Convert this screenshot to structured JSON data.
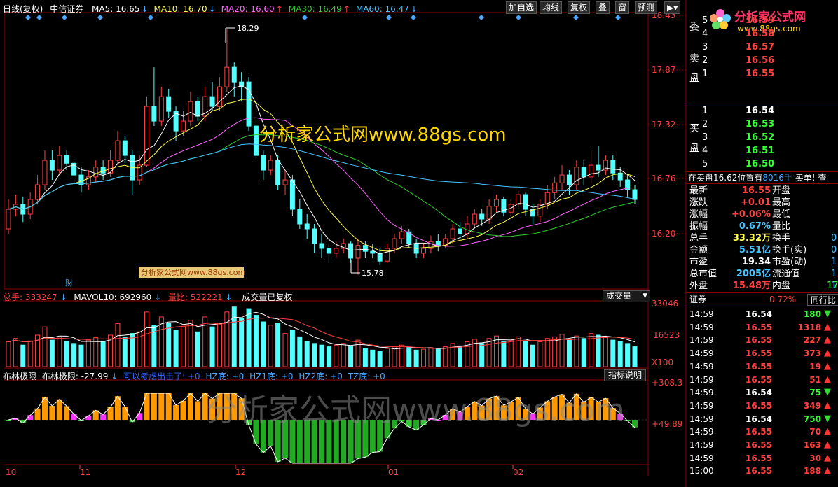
{
  "header": {
    "period": "日线(复权)",
    "stock": "中信证券",
    "ma": [
      {
        "label": "MA5: 16.65",
        "arrow": "↓",
        "arrowColor": "#49a7ff",
        "color": "#ffffff"
      },
      {
        "label": "MA10: 16.70",
        "arrow": "↓",
        "arrowColor": "#49a7ff",
        "color": "#ffff4d"
      },
      {
        "label": "MA20: 16.60",
        "arrow": "↑",
        "arrowColor": "#ff4040",
        "color": "#ff66ff"
      },
      {
        "label": "MA30: 16.49",
        "arrow": "↑",
        "arrowColor": "#ff4040",
        "color": "#33cc33"
      },
      {
        "label": "MA60: 16.47",
        "arrow": "↓",
        "arrowColor": "#49a7ff",
        "color": "#49c3ff"
      }
    ],
    "buttons": [
      "加自选",
      "均线",
      "复权",
      "叠",
      "窗",
      "预测"
    ]
  },
  "price_axis": [
    "18.43",
    "17.87",
    "17.32",
    "16.76",
    "16.20"
  ],
  "annotations": {
    "high": "18.29",
    "low": "15.78",
    "cai": "财"
  },
  "watermark_main": "分析家公式网www.88gs.com",
  "watermark_small": "分析家公式网www.88gs.com",
  "watermark_big": "分析家公式网www.88gs.com",
  "logo": {
    "title": "分析家公式网",
    "url": "www.88gs.com"
  },
  "volume_header": {
    "total_label": "总手: ",
    "total": "333247",
    "total_arrow": "↓",
    "mavol": "MAVOL10: 692960",
    "mavol_arrow": "↓",
    "liangbi_label": "量比: ",
    "liangbi": "522221",
    "liangbi_arrow": "↓",
    "note": "成交量已复权",
    "selector": "成交量"
  },
  "volume_axis": [
    "33046",
    "16523",
    "X100"
  ],
  "indicator_header": {
    "name": "布林极限",
    "value": "布林极限: -27.99",
    "arrow": "↓",
    "extra": "可以考虑出击了: +0",
    "hz": "HZ底: +0",
    "hz1": "HZ1底: +0",
    "hz2": "HZ2底: +0",
    "tz": "TZ底: +0",
    "help": "指标说明"
  },
  "indicator_axis": [
    "+308.3",
    "+49.89"
  ],
  "date_axis": [
    "10",
    "11",
    "12",
    "01",
    "02"
  ],
  "orderbook": {
    "sell_label": [
      "卖",
      "盘"
    ],
    "buy_label": [
      "买",
      "盘"
    ],
    "top_label": "委",
    "sells": [
      {
        "level": "5",
        "price": "16.59"
      },
      {
        "level": "4",
        "price": "16.58"
      },
      {
        "level": "3",
        "price": "16.57"
      },
      {
        "level": "2",
        "price": "16.56"
      },
      {
        "level": "1",
        "price": "16.55"
      }
    ],
    "buys": [
      {
        "level": "1",
        "price": "16.54"
      },
      {
        "level": "2",
        "price": "16.53"
      },
      {
        "level": "3",
        "price": "16.52"
      },
      {
        "level": "4",
        "price": "16.51"
      },
      {
        "level": "5",
        "price": "16.50"
      }
    ],
    "status": "在卖盘16.62位置有",
    "status_qty": "8016手",
    "status_action": "卖单! 查"
  },
  "stats": [
    {
      "l": "最新",
      "v": "16.55",
      "vc": "#ff4040",
      "r": "开盘"
    },
    {
      "l": "涨跌",
      "v": "+0.01",
      "vc": "#ff4040",
      "r": "最高"
    },
    {
      "l": "涨幅",
      "v": "+0.06%",
      "vc": "#ff4040",
      "r": "最低"
    },
    {
      "l": "振幅",
      "v": "0.67%",
      "vc": "#49c3ff",
      "r": "量比"
    },
    {
      "l": "总手",
      "v": "33.32万",
      "vc": "#ffff4d",
      "r": "换手"
    },
    {
      "l": "金额",
      "v": "5.51亿",
      "vc": "#49c3ff",
      "r": "换手(实)"
    },
    {
      "l": "市盈",
      "v": "19.34",
      "vc": "#ffffff",
      "r": "市盈(动)"
    },
    {
      "l": "总市值",
      "v": "2005亿",
      "vc": "#49c3ff",
      "r": "流通值"
    },
    {
      "l": "外盘",
      "v": "15.48万",
      "vc": "#ff4040",
      "r": "内盘"
    }
  ],
  "stats_cut": [
    "0",
    "0",
    "1",
    "1",
    "1"
  ],
  "stats_cut2": [
    "17"
  ],
  "sector": {
    "name": "证券",
    "change": "0.72%",
    "tab": "同行比"
  },
  "ticks": [
    {
      "t": "14:59",
      "p": "16.54",
      "pc": "#ffffff",
      "q": "180",
      "dir": "down"
    },
    {
      "t": "14:59",
      "p": "16.55",
      "pc": "#ff4040",
      "q": "1318",
      "dir": "up"
    },
    {
      "t": "14:59",
      "p": "16.55",
      "pc": "#ff4040",
      "q": "227",
      "dir": "up"
    },
    {
      "t": "14:59",
      "p": "16.55",
      "pc": "#ff4040",
      "q": "373",
      "dir": "up"
    },
    {
      "t": "14:59",
      "p": "16.55",
      "pc": "#ff4040",
      "q": "19",
      "dir": "up"
    },
    {
      "t": "14:59",
      "p": "16.55",
      "pc": "#ff4040",
      "q": "51",
      "dir": "up"
    },
    {
      "t": "14:59",
      "p": "16.54",
      "pc": "#ffffff",
      "q": "75",
      "dir": "down"
    },
    {
      "t": "14:59",
      "p": "16.55",
      "pc": "#ff4040",
      "q": "349",
      "dir": "up"
    },
    {
      "t": "14:59",
      "p": "16.54",
      "pc": "#ffffff",
      "q": "750",
      "dir": "down"
    },
    {
      "t": "14:59",
      "p": "16.55",
      "pc": "#ff4040",
      "q": "70",
      "dir": "up"
    },
    {
      "t": "14:59",
      "p": "16.55",
      "pc": "#ff4040",
      "q": "163",
      "dir": "up"
    },
    {
      "t": "14:59",
      "p": "16.55",
      "pc": "#ff4040",
      "q": "30",
      "dir": "up"
    },
    {
      "t": "15:00",
      "p": "16.55",
      "pc": "#ff4040",
      "q": "188",
      "dir": "up"
    }
  ],
  "chart_data": {
    "type": "candlestick",
    "ylim": [
      15.6,
      18.5
    ],
    "candles": [
      [
        16.25,
        16.45,
        16.55,
        16.2
      ],
      [
        16.45,
        16.5,
        16.6,
        16.38
      ],
      [
        16.5,
        16.4,
        16.58,
        16.32
      ],
      [
        16.4,
        16.55,
        16.62,
        16.35
      ],
      [
        16.55,
        16.7,
        16.8,
        16.5
      ],
      [
        16.7,
        16.95,
        17.05,
        16.65
      ],
      [
        16.95,
        16.85,
        17.05,
        16.75
      ],
      [
        16.85,
        17.0,
        17.1,
        16.8
      ],
      [
        17.0,
        16.92,
        17.05,
        16.85
      ],
      [
        16.92,
        16.8,
        16.98,
        16.72
      ],
      [
        16.8,
        16.7,
        16.88,
        16.62
      ],
      [
        16.7,
        16.78,
        16.85,
        16.65
      ],
      [
        16.78,
        16.88,
        16.95,
        16.72
      ],
      [
        16.88,
        16.82,
        16.95,
        16.75
      ],
      [
        16.82,
        16.95,
        17.05,
        16.78
      ],
      [
        16.95,
        17.15,
        17.25,
        16.9
      ],
      [
        17.15,
        17.0,
        17.2,
        16.92
      ],
      [
        17.0,
        16.75,
        17.05,
        16.6
      ],
      [
        16.75,
        16.9,
        17.0,
        16.7
      ],
      [
        16.9,
        17.5,
        17.6,
        16.88
      ],
      [
        17.5,
        17.35,
        17.9,
        17.3
      ],
      [
        17.35,
        17.6,
        17.7,
        17.3
      ],
      [
        17.6,
        17.45,
        17.68,
        17.38
      ],
      [
        17.45,
        17.25,
        17.5,
        17.15
      ],
      [
        17.25,
        17.35,
        17.45,
        17.2
      ],
      [
        17.35,
        17.55,
        17.65,
        17.3
      ],
      [
        17.55,
        17.4,
        17.6,
        17.35
      ],
      [
        17.4,
        17.6,
        17.7,
        17.35
      ],
      [
        17.6,
        17.5,
        17.75,
        17.45
      ],
      [
        17.5,
        17.7,
        17.8,
        17.45
      ],
      [
        17.7,
        17.9,
        18.29,
        17.65
      ],
      [
        17.9,
        17.75,
        17.95,
        17.6
      ],
      [
        17.75,
        17.7,
        17.85,
        17.55
      ],
      [
        17.75,
        17.3,
        17.8,
        17.25
      ],
      [
        17.3,
        17.0,
        17.35,
        16.95
      ],
      [
        17.0,
        16.85,
        17.05,
        16.75
      ],
      [
        16.85,
        16.95,
        17.0,
        16.8
      ],
      [
        16.95,
        16.7,
        17.0,
        16.65
      ],
      [
        16.7,
        16.75,
        16.85,
        16.6
      ],
      [
        16.75,
        16.45,
        16.8,
        16.38
      ],
      [
        16.45,
        16.3,
        16.55,
        16.25
      ],
      [
        16.3,
        16.25,
        16.4,
        16.15
      ],
      [
        16.25,
        16.1,
        16.3,
        16.0
      ],
      [
        16.1,
        16.05,
        16.2,
        15.95
      ],
      [
        16.05,
        16.0,
        16.1,
        15.9
      ],
      [
        16.0,
        16.05,
        16.12,
        15.95
      ],
      [
        16.05,
        16.1,
        16.15,
        16.0
      ],
      [
        16.1,
        15.95,
        16.12,
        15.9
      ],
      [
        15.95,
        16.08,
        16.15,
        15.78
      ],
      [
        16.08,
        16.02,
        16.12,
        15.95
      ],
      [
        16.02,
        16.0,
        16.1,
        15.95
      ],
      [
        16.0,
        15.92,
        16.05,
        15.88
      ],
      [
        15.92,
        16.05,
        16.1,
        15.9
      ],
      [
        16.05,
        16.15,
        16.2,
        16.0
      ],
      [
        16.15,
        16.22,
        16.28,
        16.1
      ],
      [
        16.22,
        16.1,
        16.25,
        16.05
      ],
      [
        16.1,
        16.0,
        16.15,
        15.95
      ],
      [
        16.0,
        16.05,
        16.1,
        15.95
      ],
      [
        16.05,
        16.12,
        16.18,
        16.0
      ],
      [
        16.12,
        16.08,
        16.2,
        16.02
      ],
      [
        16.08,
        16.15,
        16.2,
        16.05
      ],
      [
        16.15,
        16.25,
        16.3,
        16.1
      ],
      [
        16.25,
        16.2,
        16.32,
        16.15
      ],
      [
        16.2,
        16.3,
        16.38,
        16.15
      ],
      [
        16.3,
        16.4,
        16.45,
        16.25
      ],
      [
        16.4,
        16.35,
        16.45,
        16.28
      ],
      [
        16.35,
        16.48,
        16.55,
        16.3
      ],
      [
        16.48,
        16.55,
        16.6,
        16.42
      ],
      [
        16.55,
        16.42,
        16.58,
        16.38
      ],
      [
        16.42,
        16.5,
        16.55,
        16.38
      ],
      [
        16.5,
        16.6,
        16.65,
        16.45
      ],
      [
        16.6,
        16.45,
        16.62,
        16.38
      ],
      [
        16.45,
        16.38,
        16.5,
        16.3
      ],
      [
        16.38,
        16.5,
        16.55,
        16.32
      ],
      [
        16.5,
        16.62,
        16.7,
        16.45
      ],
      [
        16.62,
        16.72,
        16.78,
        16.55
      ],
      [
        16.72,
        16.8,
        16.9,
        16.65
      ],
      [
        16.8,
        16.7,
        16.85,
        16.6
      ],
      [
        16.7,
        16.88,
        16.95,
        16.65
      ],
      [
        16.88,
        16.78,
        16.95,
        16.7
      ],
      [
        16.78,
        16.9,
        17.05,
        16.72
      ],
      [
        16.9,
        16.85,
        17.1,
        16.78
      ],
      [
        16.85,
        16.95,
        17.0,
        16.8
      ],
      [
        16.95,
        16.82,
        17.0,
        16.75
      ],
      [
        16.82,
        16.75,
        16.88,
        16.68
      ],
      [
        16.75,
        16.65,
        16.8,
        16.58
      ],
      [
        16.65,
        16.55,
        16.7,
        16.5
      ]
    ],
    "volumes": [
      150,
      170,
      130,
      155,
      190,
      240,
      160,
      180,
      150,
      140,
      130,
      160,
      175,
      150,
      190,
      260,
      175,
      200,
      210,
      330,
      250,
      300,
      260,
      220,
      240,
      280,
      210,
      300,
      240,
      260,
      330,
      360,
      290,
      350,
      310,
      270,
      250,
      260,
      200,
      220,
      180,
      150,
      140,
      130,
      120,
      130,
      140,
      120,
      160,
      110,
      100,
      95,
      110,
      120,
      130,
      115,
      100,
      105,
      115,
      110,
      120,
      140,
      125,
      150,
      165,
      140,
      170,
      185,
      150,
      160,
      180,
      150,
      130,
      150,
      170,
      180,
      195,
      160,
      185,
      170,
      200,
      190,
      175,
      160,
      150,
      140,
      120
    ],
    "vol_ylim": [
      0,
      380
    ]
  }
}
